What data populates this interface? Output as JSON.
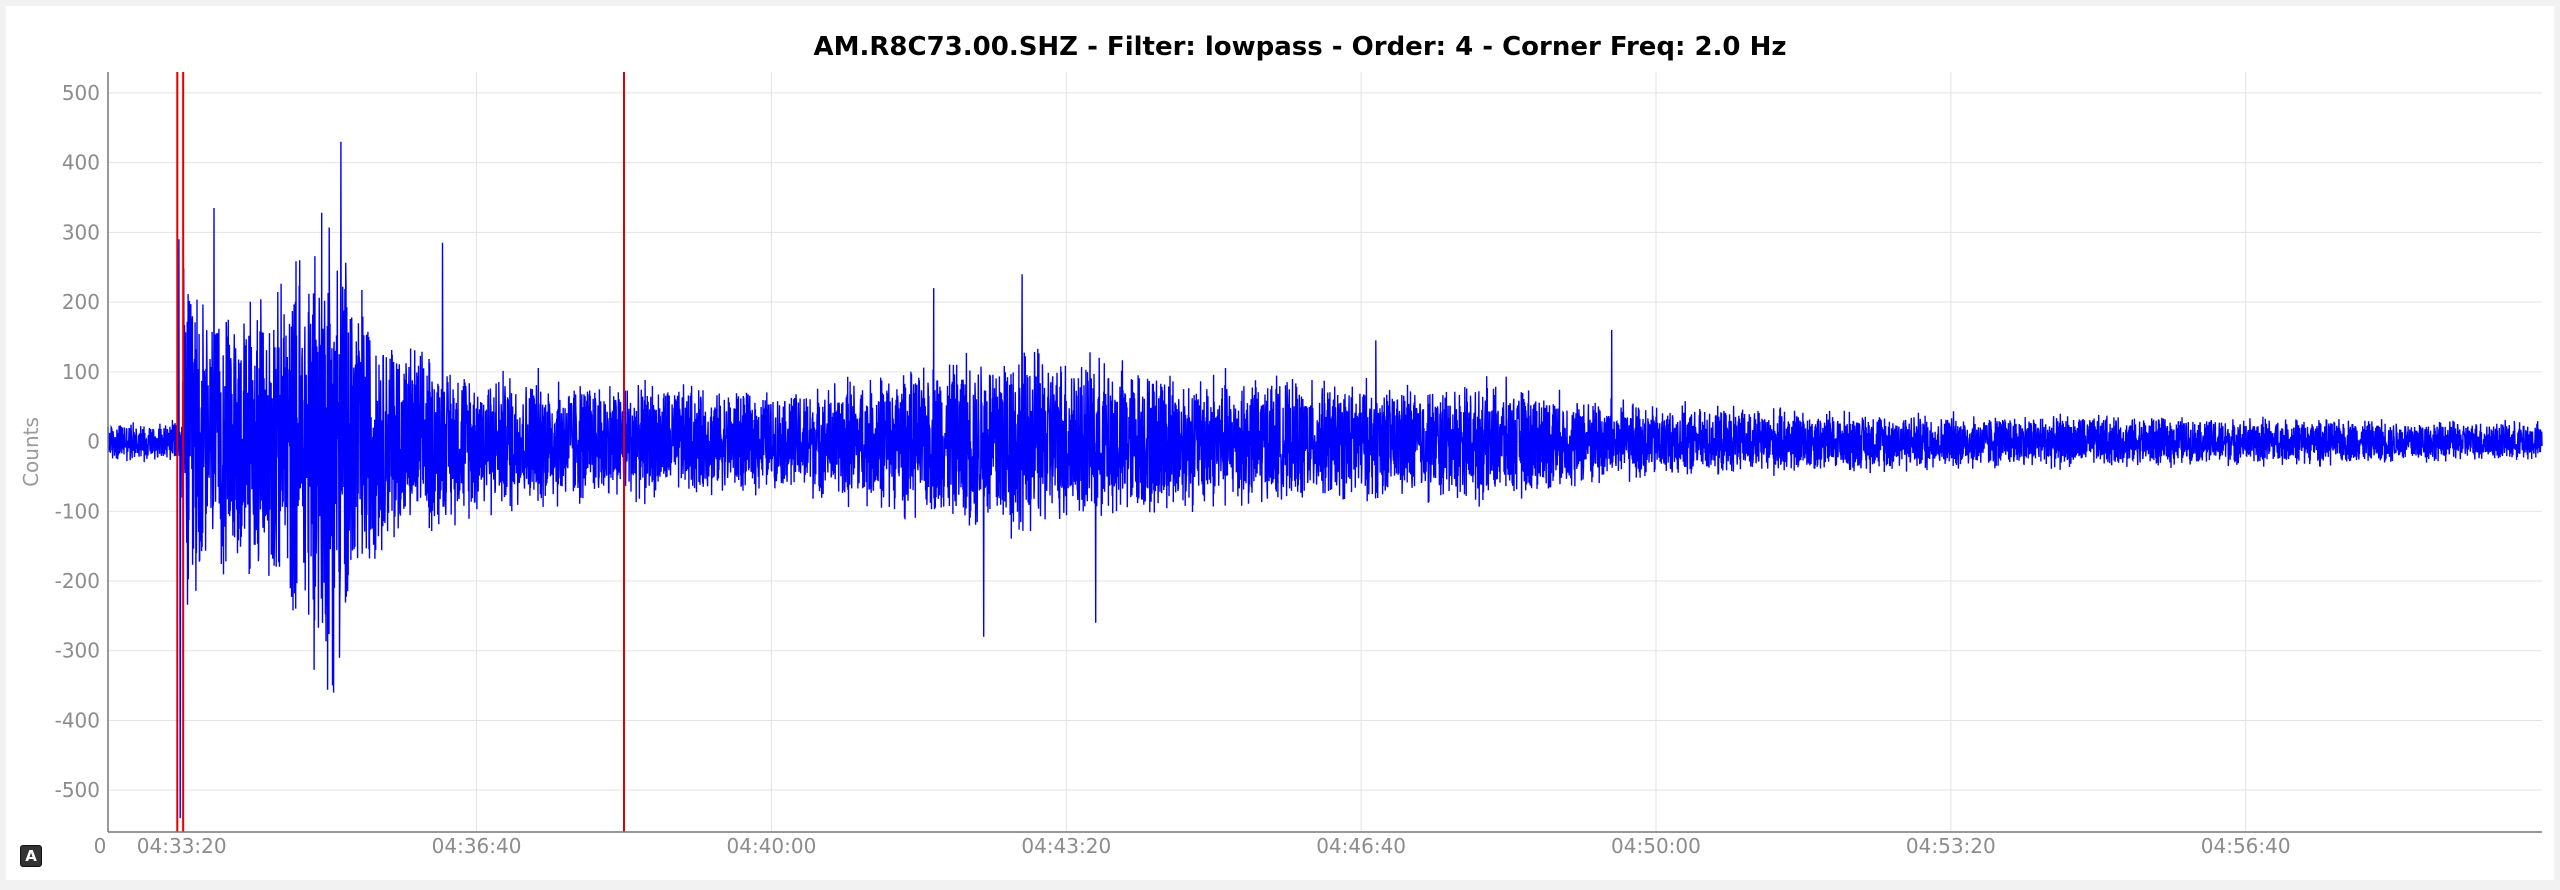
{
  "chart_data": {
    "type": "line",
    "title": "AM.R8C73.00.SHZ - Filter: lowpass - Order: 4 - Corner Freq: 2.0 Hz",
    "xlabel": "",
    "ylabel": "Counts",
    "x_start": "04:32:30",
    "x_end": "05:00:01",
    "ylim": [
      -560,
      530
    ],
    "yticks": [
      500,
      400,
      300,
      200,
      100,
      0,
      -100,
      -200,
      -300,
      -400,
      -500
    ],
    "xtick_labels": [
      "04:33:20",
      "04:36:40",
      "04:40:00",
      "04:43:20",
      "04:46:40",
      "04:50:00",
      "04:53:20",
      "04:56:40"
    ],
    "xtick_times": [
      "04:33:20",
      "04:36:40",
      "04:40:00",
      "04:43:20",
      "04:46:40",
      "04:50:00",
      "04:53:20",
      "04:56:40"
    ],
    "grid": true,
    "series": [
      {
        "color": "#0000ff",
        "envelope": [
          {
            "t": "04:32:30",
            "amp": 30
          },
          {
            "t": "04:33:20",
            "amp": 32
          },
          {
            "t": "04:33:21",
            "amp": 290
          },
          {
            "t": "04:33:40",
            "amp": 200
          },
          {
            "t": "04:34:10",
            "amp": 210
          },
          {
            "t": "04:34:40",
            "amp": 260
          },
          {
            "t": "04:35:00",
            "amp": 380
          },
          {
            "t": "04:35:30",
            "amp": 180
          },
          {
            "t": "04:36:00",
            "amp": 140
          },
          {
            "t": "04:36:40",
            "amp": 110
          },
          {
            "t": "04:38:20",
            "amp": 90
          },
          {
            "t": "04:40:00",
            "amp": 75
          },
          {
            "t": "04:41:40",
            "amp": 110
          },
          {
            "t": "04:42:40",
            "amp": 150
          },
          {
            "t": "04:43:40",
            "amp": 125
          },
          {
            "t": "04:45:00",
            "amp": 100
          },
          {
            "t": "04:46:40",
            "amp": 90
          },
          {
            "t": "04:48:20",
            "amp": 85
          },
          {
            "t": "04:50:00",
            "amp": 55
          },
          {
            "t": "04:53:20",
            "amp": 42
          },
          {
            "t": "04:56:40",
            "amp": 36
          },
          {
            "t": "05:00:01",
            "amp": 30
          }
        ],
        "peaks": [
          {
            "t": "04:33:18",
            "y": 290
          },
          {
            "t": "04:33:19",
            "y": -540
          },
          {
            "t": "04:33:42",
            "y": 335
          },
          {
            "t": "04:34:40",
            "y": 260
          },
          {
            "t": "04:35:03",
            "y": 440
          },
          {
            "t": "04:35:08",
            "y": 430
          },
          {
            "t": "04:35:03",
            "y": -360
          },
          {
            "t": "04:35:07",
            "y": -310
          },
          {
            "t": "04:36:17",
            "y": 285
          },
          {
            "t": "04:41:50",
            "y": 220
          },
          {
            "t": "04:42:24",
            "y": -280
          },
          {
            "t": "04:42:50",
            "y": 240
          },
          {
            "t": "04:43:40",
            "y": -260
          },
          {
            "t": "04:46:50",
            "y": 145
          },
          {
            "t": "04:49:30",
            "y": 160
          }
        ]
      }
    ],
    "markers": [
      {
        "t": "04:33:17",
        "color": "#e00000"
      },
      {
        "t": "04:33:21",
        "color": "#e00000"
      },
      {
        "t": "04:38:20",
        "color": "#e00000"
      }
    ],
    "x_origin_label": "0"
  },
  "badge": "A"
}
